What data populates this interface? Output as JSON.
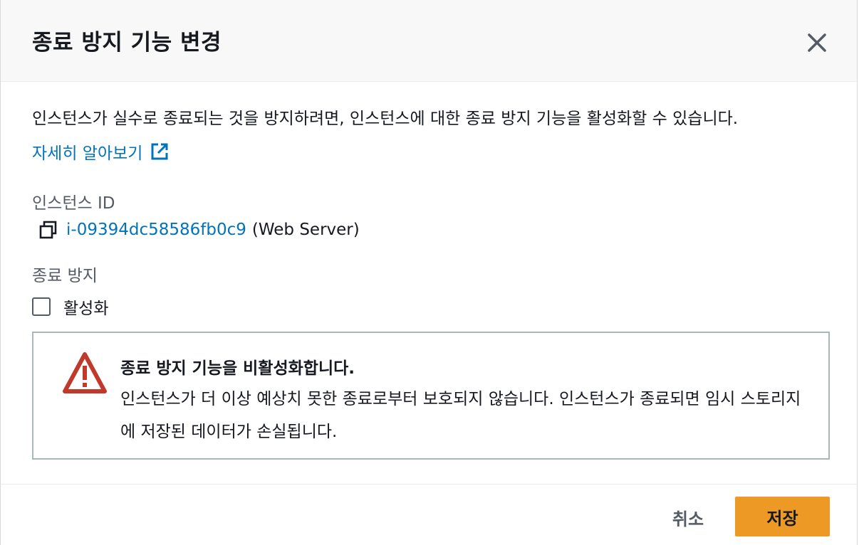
{
  "modal": {
    "title": "종료 방지 기능 변경",
    "description": "인스턴스가 실수로 종료되는 것을 방지하려면, 인스턴스에 대한 종료 방지 기능을 활성화할 수 있습니다.",
    "learn_more": "자세히 알아보기"
  },
  "instance": {
    "label": "인스턴스 ID",
    "id": "i-09394dc58586fb0c9",
    "name": "(Web Server)"
  },
  "termination_protection": {
    "label": "종료 방지",
    "checkbox_label": "활성화",
    "checked": false
  },
  "alert": {
    "title": "종료 방지 기능을 비활성화합니다.",
    "body": "인스턴스가 더 이상 예상치 못한 종료로부터 보호되지 않습니다. 인스턴스가 종료되면 임시 스토리지에 저장된 데이터가 손실됩니다."
  },
  "footer": {
    "cancel": "취소",
    "save": "저장"
  },
  "colors": {
    "link": "#0073bb",
    "primary": "#ec9926",
    "warning": "#c0392b"
  }
}
